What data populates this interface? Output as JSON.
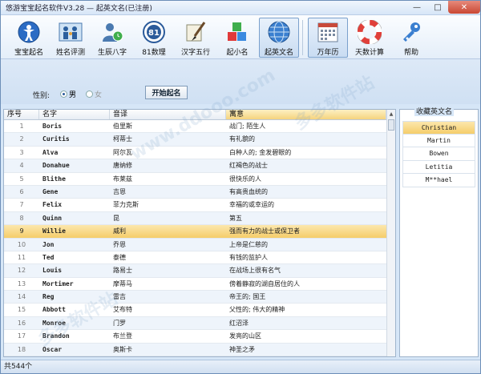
{
  "window": {
    "title": "悠游宝宝起名软件V3.28  —  起英文名(已注册)",
    "min": "—",
    "max": "□",
    "close": "✕"
  },
  "toolbar": {
    "items": [
      {
        "label": "宝宝起名",
        "icon": "baby-figure-icon"
      },
      {
        "label": "姓名评测",
        "icon": "family-icon"
      },
      {
        "label": "生辰八字",
        "icon": "person-clock-icon"
      },
      {
        "label": "81数理",
        "icon": "number-81-icon"
      },
      {
        "label": "汉字五行",
        "icon": "brush-icon"
      },
      {
        "label": "起小名",
        "icon": "blocks-icon"
      },
      {
        "label": "起英文名",
        "icon": "globe-icon"
      },
      {
        "label": "万年历",
        "icon": "calendar-icon"
      },
      {
        "label": "天数计算",
        "icon": "lifebuoy-icon"
      },
      {
        "label": "帮助",
        "icon": "key-icon"
      }
    ]
  },
  "options": {
    "gender_label": "性别:",
    "male": "男",
    "female": "女",
    "start_button": "开始起名"
  },
  "table": {
    "headers": [
      "序号",
      "名字",
      "音译",
      "寓意"
    ],
    "rows": [
      [
        "1",
        "Boris",
        "伯里斯",
        "战门; 陌生人"
      ],
      [
        "2",
        "Curitis",
        "柯蒂士",
        "有礼貌的"
      ],
      [
        "3",
        "Alva",
        "阿尔瓦",
        "白种人的; 金发碧眼的"
      ],
      [
        "4",
        "Donahue",
        "唐纳修",
        "红褐色的战士"
      ],
      [
        "5",
        "Blithe",
        "布莱兹",
        "很快乐的人"
      ],
      [
        "6",
        "Gene",
        "吉恩",
        "有高贵血统的"
      ],
      [
        "7",
        "Felix",
        "菲力克斯",
        "幸福的或幸运的"
      ],
      [
        "8",
        "Quinn",
        "昆",
        "第五"
      ],
      [
        "9",
        "Willie",
        "威利",
        "强而有力的战士或保卫者"
      ],
      [
        "10",
        "Jon",
        "乔恩",
        "上帝是仁慈的"
      ],
      [
        "11",
        "Ted",
        "泰德",
        "有钱的监护人"
      ],
      [
        "12",
        "Louis",
        "路易士",
        "在战场上很有名气"
      ],
      [
        "13",
        "Mortimer",
        "摩蒂马",
        "傍着静寂的湖自居住的人"
      ],
      [
        "14",
        "Reg",
        "雷吉",
        "帝王的; 国王"
      ],
      [
        "15",
        "Abbott",
        "艾布特",
        "父性的; 伟大的精神"
      ],
      [
        "16",
        "Monroe",
        "门罗",
        "红沼泽"
      ],
      [
        "17",
        "Brandon",
        "布兰登",
        "发亮的山区"
      ],
      [
        "18",
        "Oscar",
        "奥斯卡",
        "神圣之矛"
      ]
    ],
    "selected_row": "9"
  },
  "favorites": {
    "title": "收藏英文名",
    "items": [
      "Christian",
      "Martin",
      "Bowen",
      "Letitia",
      "M**hael"
    ]
  },
  "status": {
    "text": "共544个"
  },
  "watermark": {
    "text1": "多多软件站",
    "text2": "www.ddooo.com"
  },
  "colors": {
    "selection": "#f5cd6a",
    "background": "#d6e6f7",
    "accent": "#2a5a9a"
  }
}
